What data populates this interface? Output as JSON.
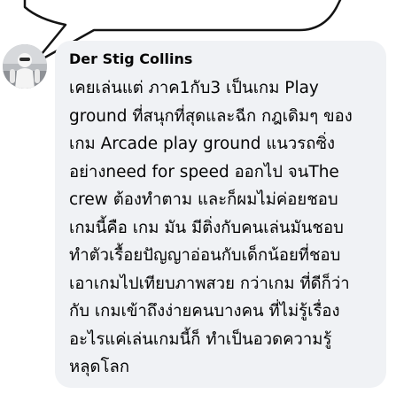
{
  "comment": {
    "author": "Der Stig Collins",
    "avatar_icon": "user-avatar-icon",
    "lines": [
      "เคยเล่นแต่ ภาค1กับ3 เป็นเกม Play",
      "ground ที่สนุกที่สุดและฉีก กฎเดิมๆ ของ",
      "เกม Arcade play ground แนวรถซิ่ง",
      "อย่างneed for speed ออกไป จนThe",
      "crew ต้องทำตาม และก็ผมไม่ค่อยชอบ",
      "เกมนี้คือ เกม มัน มีติ่งกับคนเล่นมันชอบ",
      "ทำตัวเรื้อยปัญญาอ่อนกับเด็กน้อยที่ชอบ",
      "เอาเกมไปเทียบภาพสวย กว่าเกม ที่ดีก็ว่า",
      "กับ เกมเข้าถึงง่ายคนบางคน ที่ไม่รู้เรื่อง",
      "อะไรแค่เล่นเกมนี้ก็ ทำเป็นอวดความรู้",
      "หลุดโลก"
    ]
  },
  "colors": {
    "bubble_background": "#f0f2f5",
    "text": "#050505"
  }
}
